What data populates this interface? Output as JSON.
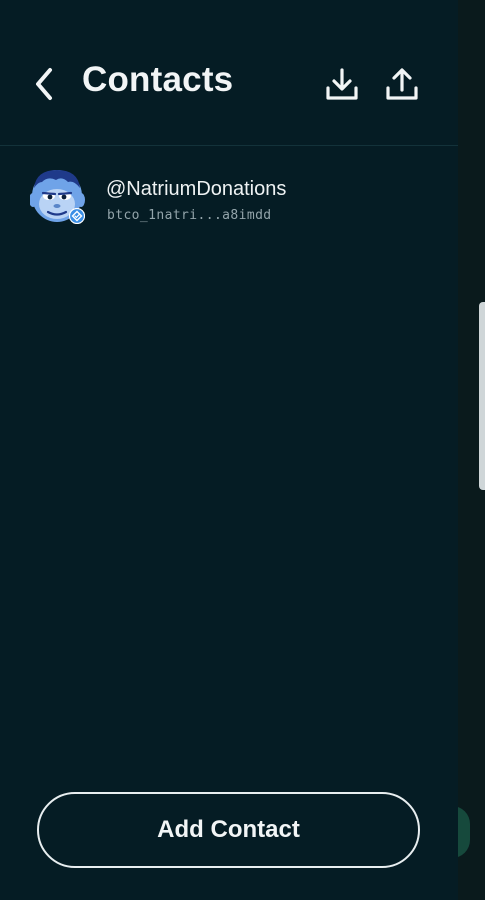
{
  "header": {
    "title": "Contacts",
    "back_icon": "chevron-left-icon",
    "import_icon": "download-icon",
    "export_icon": "upload-icon"
  },
  "contacts": [
    {
      "name": "@NatriumDonations",
      "address": "btco_1natri...a8imdd",
      "avatar_icon": "monkey-avatar-icon",
      "verified_icon": "verified-badge-icon"
    }
  ],
  "footer": {
    "add_contact_label": "Add Contact"
  },
  "colors": {
    "background": "#051c24",
    "text": "#f2f5f6",
    "secondary_text": "#93a4aa",
    "avatar_blue": "#6fa3e8",
    "verified_blue": "#3a8ee6"
  }
}
